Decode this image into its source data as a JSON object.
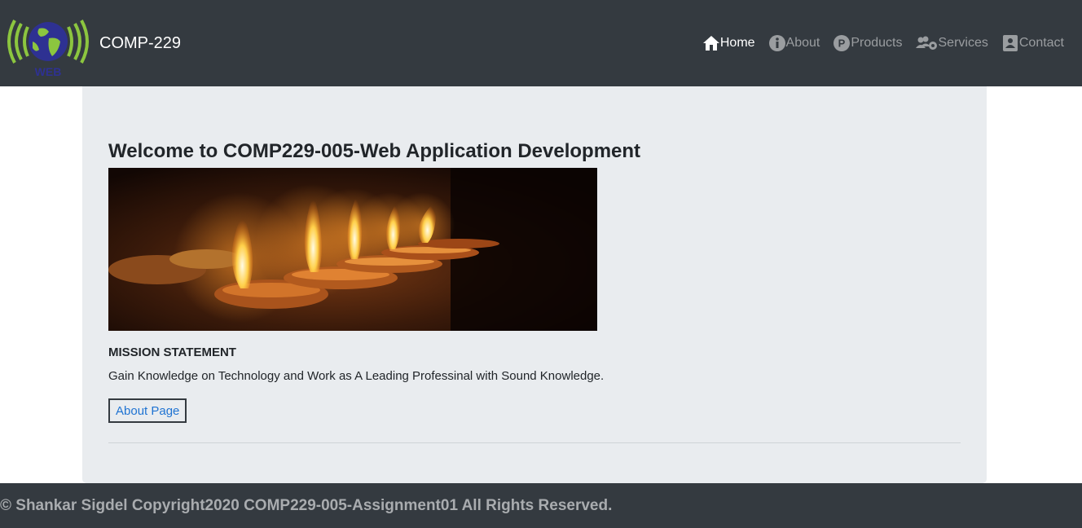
{
  "brand": {
    "name": "COMP-229",
    "logo_text": "WEB",
    "logo_icon": "globe-signal-logo"
  },
  "nav": {
    "items": [
      {
        "label": "Home",
        "icon": "home-icon",
        "active": true
      },
      {
        "label": "About",
        "icon": "info-icon",
        "active": false
      },
      {
        "label": "Products",
        "icon": "p-circle-icon",
        "active": false
      },
      {
        "label": "Services",
        "icon": "users-gear-icon",
        "active": false
      },
      {
        "label": "Contact",
        "icon": "contact-card-icon",
        "active": false
      }
    ]
  },
  "main": {
    "heading": "Welcome to COMP229-005-Web Application Development",
    "image_alt": "diya-lamps-image",
    "mission_title": "MISSION STATEMENT",
    "mission_text": "Gain Knowledge on Technology and Work as A Leading Professinal with Sound Knowledge.",
    "button_label": "About Page"
  },
  "footer": {
    "text": "© Shankar Sigdel Copyright2020 COMP229-005-Assignment01 All Rights Reserved."
  },
  "colors": {
    "navbar": "#343a40",
    "jumbotron": "#e9ecef",
    "link": "#1f73d2",
    "logo_green": "#8cc63f",
    "logo_blue": "#2e3192"
  }
}
